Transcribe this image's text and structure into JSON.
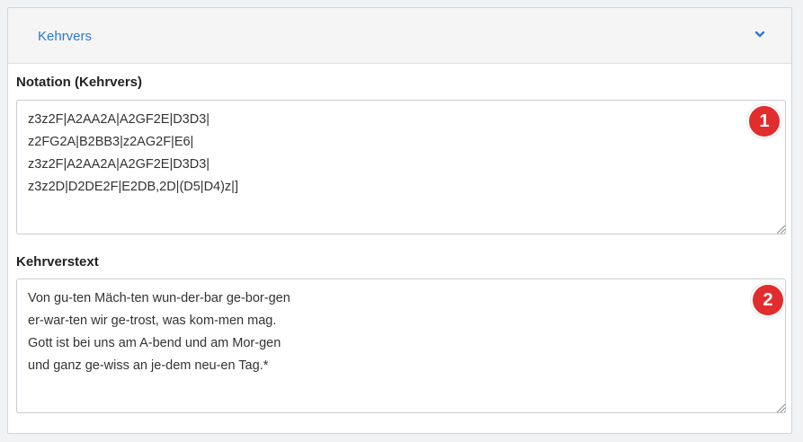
{
  "section": {
    "title": "Kehrvers",
    "collapse_icon": "chevron-down-icon",
    "accent_color": "#2b7bcf"
  },
  "notation": {
    "label": "Notation (Kehrvers)",
    "value": "z3z2F|A2AA2A|A2GF2E|D3D3|\nz2FG2A|B2BB3|z2AG2F|E6|\nz3z2F|A2AA2A|A2GF2E|D3D3|\nz3z2D|D2DE2F|E2DB,2D|(D5|D4)z|]",
    "badge": "1"
  },
  "text": {
    "label": "Kehrverstext",
    "value": "Von gu-ten Mäch-ten wun-der-bar ge-bor-gen\ner-war-ten wir ge-trost, was kom-men mag.\nGott ist bei uns am A-bend und am Mor-gen\nund ganz ge-wiss an je-dem neu-en Tag.*",
    "badge": "2"
  },
  "badge_color": "#e12d2d"
}
